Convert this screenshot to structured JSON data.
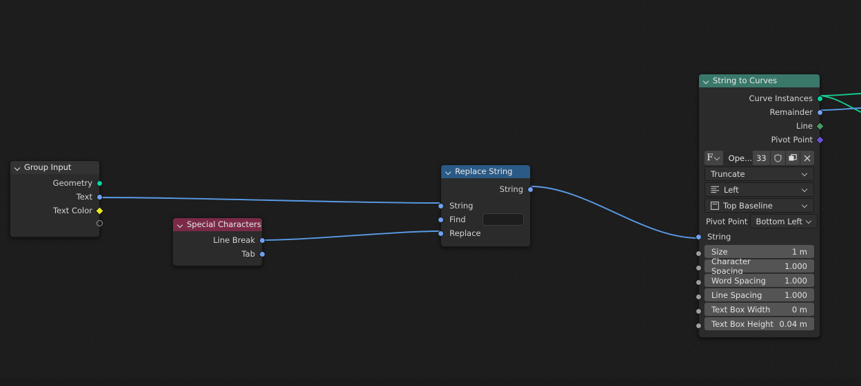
{
  "app": {
    "editor": "Geometry Node Editor",
    "background_color": "#1d1d1d",
    "grid_dot_color": "#242424"
  },
  "socket_colors": {
    "geometry": "#00d6a3",
    "string": "#70a0f0",
    "color": "#e8e81f",
    "line_style": "#4a9b62",
    "pivot": "#6c4fd8"
  },
  "nodes": {
    "group_input": {
      "title": "Group Input",
      "header_color": "#333333",
      "outputs": [
        {
          "label": "Geometry",
          "type": "geometry"
        },
        {
          "label": "Text",
          "type": "string"
        },
        {
          "label": "Text Color",
          "type": "color"
        },
        {
          "label": "",
          "type": "virtual"
        }
      ]
    },
    "special_characters": {
      "title": "Special Characters",
      "header_color": "#7a2a47",
      "outputs": [
        {
          "label": "Line Break",
          "type": "string"
        },
        {
          "label": "Tab",
          "type": "string"
        }
      ]
    },
    "replace_string": {
      "title": "Replace String",
      "header_color": "#2b5a86",
      "outputs": [
        {
          "label": "String",
          "type": "string"
        }
      ],
      "inputs": [
        {
          "label": "String",
          "type": "string",
          "value": ""
        },
        {
          "label": "Find",
          "type": "string",
          "value": ""
        },
        {
          "label": "Replace",
          "type": "string",
          "value": ""
        }
      ]
    },
    "string_to_curves": {
      "title": "String to Curves",
      "header_color": "#39786a",
      "outputs": [
        {
          "label": "Curve Instances",
          "type": "geometry"
        },
        {
          "label": "Remainder",
          "type": "string"
        },
        {
          "label": "Line",
          "type": "line_style"
        },
        {
          "label": "Pivot Point",
          "type": "pivot"
        }
      ],
      "font": {
        "browse_icon": "font-browse-icon",
        "glyph": "F",
        "name": "Ope...",
        "users": "33",
        "fake_user_icon": "shield-icon",
        "duplicate_icon": "copy-icon",
        "unlink_icon": "x-icon"
      },
      "overflow": "Truncate",
      "align_x": "Left",
      "align_y": "Top Baseline",
      "pivot_point_label": "Pivot Point",
      "pivot_point_value": "Bottom Left",
      "string_input_label": "String",
      "values": [
        {
          "label": "Size",
          "value": "1 m"
        },
        {
          "label": "Character Spacing",
          "value": "1.000"
        },
        {
          "label": "Word Spacing",
          "value": "1.000"
        },
        {
          "label": "Line Spacing",
          "value": "1.000"
        },
        {
          "label": "Text Box Width",
          "value": "0 m"
        },
        {
          "label": "Text Box Height",
          "value": "0.04 m"
        }
      ]
    }
  }
}
